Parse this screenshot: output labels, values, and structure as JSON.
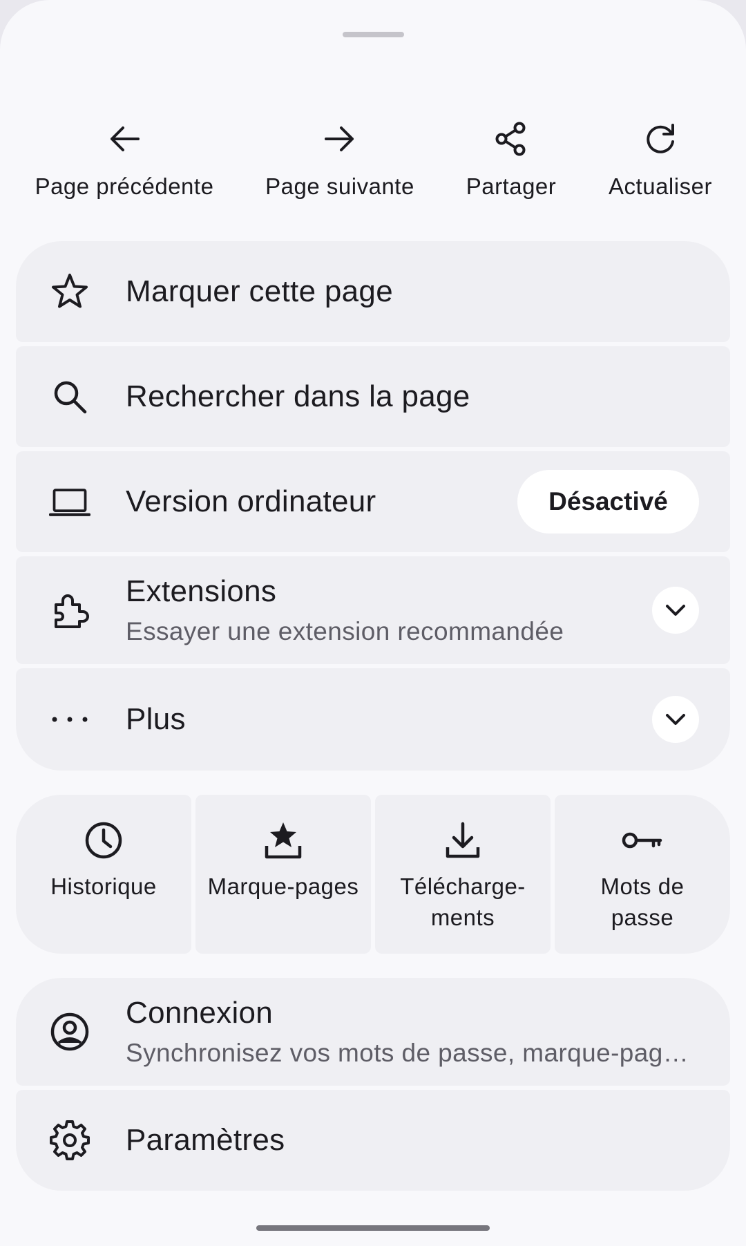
{
  "nav": [
    {
      "label": "Page précédente",
      "icon": "arrow-back-icon"
    },
    {
      "label": "Page suivante",
      "icon": "arrow-forward-icon"
    },
    {
      "label": "Partager",
      "icon": "share-icon"
    },
    {
      "label": "Actualiser",
      "icon": "refresh-icon"
    }
  ],
  "menu": {
    "bookmark_page": {
      "title": "Marquer cette page",
      "icon": "star-outline-icon"
    },
    "find_in_page": {
      "title": "Rechercher dans la page",
      "icon": "search-icon"
    },
    "desktop_site": {
      "title": "Version ordinateur",
      "state": "Désactivé",
      "icon": "laptop-icon"
    },
    "extensions": {
      "title": "Extensions",
      "subtitle": "Essayer une extension recommandée",
      "icon": "puzzle-icon"
    },
    "more": {
      "title": "Plus",
      "icon": "more-horizontal-icon"
    }
  },
  "tiles": [
    {
      "label": "Historique",
      "icon": "clock-icon"
    },
    {
      "label": "Marque-pages",
      "icon": "bookmark-tray-icon"
    },
    {
      "label": "Télécharge-\nments",
      "icon": "download-icon"
    },
    {
      "label": "Mots de\npasse",
      "icon": "key-icon"
    }
  ],
  "account": {
    "sign_in": {
      "title": "Connexion",
      "subtitle": "Synchronisez vos mots de passe, marque-pages et plus",
      "icon": "account-circle-icon"
    },
    "settings": {
      "title": "Paramètres",
      "icon": "gear-icon"
    }
  },
  "colors": {
    "sheet_background": "#f8f8fb",
    "row_background": "#efeff3",
    "text_primary": "#1c1b20",
    "text_secondary": "#5e5d66"
  }
}
